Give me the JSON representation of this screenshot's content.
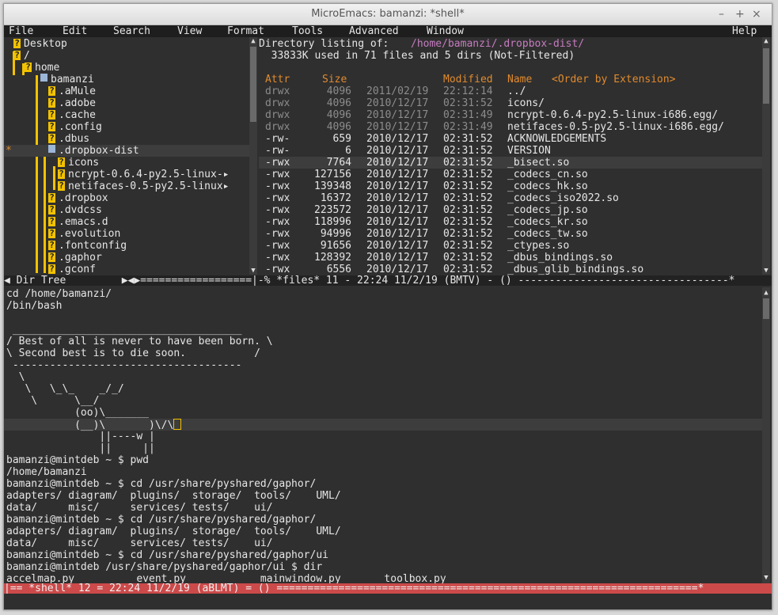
{
  "window": {
    "title": "MicroEmacs: bamanzi: *shell*",
    "buttons": [
      "–",
      "+",
      "×"
    ]
  },
  "menu": [
    "File",
    "Edit",
    "Search",
    "View",
    "Format",
    "Tools",
    "Advanced",
    "Window",
    "Help"
  ],
  "tree": {
    "items": [
      {
        "label": "Desktop",
        "mark": ""
      },
      {
        "label": "/",
        "mark": ""
      },
      {
        "label": "home",
        "mark": ""
      },
      {
        "label": "bamanzi",
        "mark": ""
      },
      {
        "label": ".aMule",
        "mark": ""
      },
      {
        "label": ".adobe",
        "mark": ""
      },
      {
        "label": ".cache",
        "mark": ""
      },
      {
        "label": ".config",
        "mark": ""
      },
      {
        "label": ".dbus",
        "mark": ""
      },
      {
        "label": ".dropbox-dist",
        "mark": "*"
      },
      {
        "label": "icons",
        "mark": ""
      },
      {
        "label": "ncrypt-0.6.4-py2.5-linux-▸",
        "mark": ""
      },
      {
        "label": "netifaces-0.5-py2.5-linux▸",
        "mark": ""
      },
      {
        "label": ".dropbox",
        "mark": ""
      },
      {
        "label": ".dvdcss",
        "mark": ""
      },
      {
        "label": ".emacs.d",
        "mark": ""
      },
      {
        "label": ".evolution",
        "mark": ""
      },
      {
        "label": ".fontconfig",
        "mark": ""
      },
      {
        "label": ".gaphor",
        "mark": ""
      },
      {
        "label": ".gconf",
        "mark": ""
      }
    ],
    "mode_line": "◀ Dir Tree         ▶◀▶===================================="
  },
  "listing": {
    "header_label": "Directory listing of: ",
    "path": "/home/bamanzi/.dropbox-dist/",
    "summary": "  33833K used in 71 files and 5 dirs (Not-Filtered)",
    "columns": {
      "attr": "Attr",
      "size": "Size",
      "modified": "Modified",
      "name": "Name",
      "order": "<Order by Extension>"
    },
    "rows": [
      {
        "attr": "drwx",
        "size": "4096",
        "date": "2011/02/19",
        "time": "22:12:14",
        "name": "../",
        "dir": true
      },
      {
        "attr": "drwx",
        "size": "4096",
        "date": "2010/12/17",
        "time": "02:31:52",
        "name": "icons/",
        "dir": true
      },
      {
        "attr": "drwx",
        "size": "4096",
        "date": "2010/12/17",
        "time": "02:31:49",
        "name": "ncrypt-0.6.4-py2.5-linux-i686.egg/",
        "dir": true
      },
      {
        "attr": "drwx",
        "size": "4096",
        "date": "2010/12/17",
        "time": "02:31:49",
        "name": "netifaces-0.5-py2.5-linux-i686.egg/",
        "dir": true
      },
      {
        "attr": "-rw-",
        "size": "659",
        "date": "2010/12/17",
        "time": "02:31:52",
        "name": "ACKNOWLEDGEMENTS",
        "dir": false
      },
      {
        "attr": "-rw-",
        "size": "6",
        "date": "2010/12/17",
        "time": "02:31:52",
        "name": "VERSION",
        "dir": false
      },
      {
        "attr": "-rwx",
        "size": "7764",
        "date": "2010/12/17",
        "time": "02:31:52",
        "name": "_bisect.so",
        "dir": false
      },
      {
        "attr": "-rwx",
        "size": "127156",
        "date": "2010/12/17",
        "time": "02:31:52",
        "name": "_codecs_cn.so",
        "dir": false
      },
      {
        "attr": "-rwx",
        "size": "139348",
        "date": "2010/12/17",
        "time": "02:31:52",
        "name": "_codecs_hk.so",
        "dir": false
      },
      {
        "attr": "-rwx",
        "size": "16372",
        "date": "2010/12/17",
        "time": "02:31:52",
        "name": "_codecs_iso2022.so",
        "dir": false
      },
      {
        "attr": "-rwx",
        "size": "223572",
        "date": "2010/12/17",
        "time": "02:31:52",
        "name": "_codecs_jp.so",
        "dir": false
      },
      {
        "attr": "-rwx",
        "size": "118996",
        "date": "2010/12/17",
        "time": "02:31:52",
        "name": "_codecs_kr.so",
        "dir": false
      },
      {
        "attr": "-rwx",
        "size": "94996",
        "date": "2010/12/17",
        "time": "02:31:52",
        "name": "_codecs_tw.so",
        "dir": false
      },
      {
        "attr": "-rwx",
        "size": "91656",
        "date": "2010/12/17",
        "time": "02:31:52",
        "name": "_ctypes.so",
        "dir": false
      },
      {
        "attr": "-rwx",
        "size": "128392",
        "date": "2010/12/17",
        "time": "02:31:52",
        "name": "_dbus_bindings.so",
        "dir": false
      },
      {
        "attr": "-rwx",
        "size": "6556",
        "date": "2010/12/17",
        "time": "02:31:52",
        "name": "_dbus_glib_bindings.so",
        "dir": false
      }
    ],
    "mode_line": "|-% *files* 11 - 22:24 11/2/19 (BMTV) - () ----------------------------------*"
  },
  "shell": {
    "lines": [
      "cd /home/bamanzi/",
      "/bin/bash",
      "",
      " _____________________________________",
      "/ Best of all is never to have been born. \\",
      "\\ Second best is to die soon.           /",
      " -------------------------------------",
      "  \\",
      "   \\   \\_\\_    _/_/",
      "    \\      \\__/",
      "           (oo)\\_______",
      "           (__)\\       )\\/\\",
      "               ||----w |",
      "               ||     ||",
      "bamanzi@mintdeb ~ $ pwd",
      "/home/bamanzi",
      "bamanzi@mintdeb ~ $ cd /usr/share/pyshared/gaphor/",
      "adapters/ diagram/  plugins/  storage/  tools/    UML/",
      "data/     misc/     services/ tests/    ui/",
      "bamanzi@mintdeb ~ $ cd /usr/share/pyshared/gaphor/",
      "adapters/ diagram/  plugins/  storage/  tools/    UML/",
      "data/     misc/     services/ tests/    ui/",
      "bamanzi@mintdeb ~ $ cd /usr/share/pyshared/gaphor/ui",
      "bamanzi@mintdeb /usr/share/pyshared/gaphor/ui $ dir",
      "accelmap.py          event.py            mainwindow.py       toolbox.py"
    ],
    "mode_line": "|== *shell* 12 = 22:24 11/2/19 (aBLMT) = () ====================================================================*"
  },
  "colors": {
    "orange": "#e08a2e",
    "magenta": "#c67cc0",
    "modeline_red": "#cc4a4a",
    "folder_yellow": "#f2c200"
  }
}
